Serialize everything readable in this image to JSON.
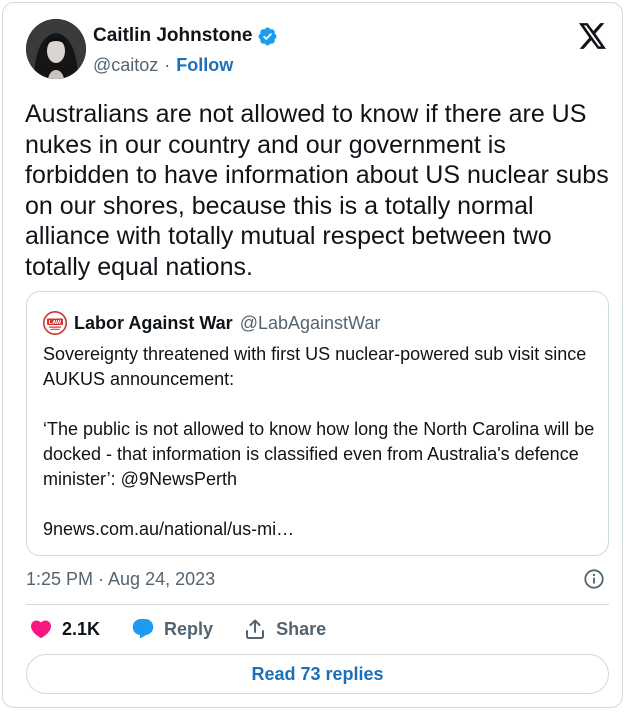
{
  "author": {
    "name": "Caitlin Johnstone",
    "handle": "@caitoz",
    "separator": "·",
    "follow_label": "Follow"
  },
  "tweet": {
    "text": "Australians are not allowed to know if there are US nukes in our country and our government is forbidden to have information about US nuclear subs on our shores, because this is a totally normal alliance with totally mutual respect between two totally equal nations."
  },
  "quote": {
    "logo_text": "LAW",
    "name": "Labor Against War",
    "handle": "@LabAgainstWar",
    "paragraphs": [
      "Sovereignty threatened with first US nuclear-powered sub visit since AUKUS announcement:",
      "‘The public is not allowed to know how long the North Carolina will be docked - that information is classified even from Australia's defence minister’: @9NewsPerth",
      "9news.com.au/national/us-mi…"
    ]
  },
  "meta": {
    "timestamp": "1:25 PM · Aug 24, 2023"
  },
  "actions": {
    "like_count": "2.1K",
    "reply_label": "Reply",
    "share_label": "Share"
  },
  "read_replies_label": "Read 73 replies",
  "colors": {
    "accent": "#1d6fb8",
    "like": "#f91880",
    "verified": "#1d9bf0",
    "muted": "#536471",
    "border": "#cfd9de"
  },
  "icons": {
    "brand": "x-logo-icon",
    "verified": "verified-badge-icon",
    "info": "info-icon",
    "like": "heart-icon",
    "reply": "speech-bubble-icon",
    "share": "share-upload-icon"
  }
}
